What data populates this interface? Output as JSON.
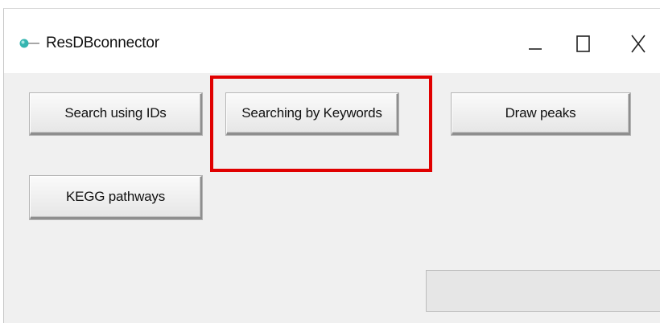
{
  "window": {
    "title": "ResDBconnector",
    "controls": {
      "minimize_icon": "minimize-icon",
      "maximize_icon": "maximize-icon",
      "close_icon": "close-icon"
    }
  },
  "buttons": {
    "search_ids": "Search using IDs",
    "keywords": "Searching by Keywords",
    "draw_peaks": "Draw peaks",
    "kegg": "KEGG pathways"
  },
  "annotation": {
    "highlight_color": "#e00000",
    "highlighted_item": "Searching by Keywords"
  },
  "progress": {
    "value": 0
  },
  "colors": {
    "window_bg": "#f0f0f0",
    "titlebar_bg": "#ffffff",
    "app_icon": "#2aa6a6"
  }
}
